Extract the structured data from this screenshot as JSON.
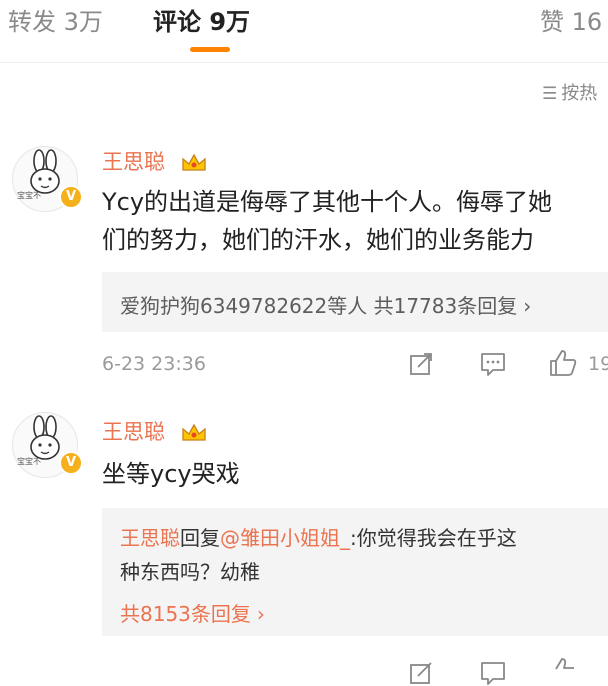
{
  "tabs": [
    {
      "label": "转发 3万"
    },
    {
      "label": "评论 9万"
    },
    {
      "label": "赞 16"
    }
  ],
  "sort_label": "按热",
  "comments": [
    {
      "username": "王思聪",
      "avatar_caption": "宝宝不",
      "text_lines": [
        "Ycy的出道是侮辱了其他十个人。侮辱了她",
        "们的努力，她们的汗水，她们的业务能力"
      ],
      "reply_summary": "爱狗护狗6349782622等人 共17783条回复",
      "time": "6-23 23:36",
      "like_count": "19"
    },
    {
      "username": "王思聪",
      "avatar_caption": "宝宝不",
      "text_lines": [
        "坐等ycy哭戏"
      ],
      "reply": {
        "author": "王思聪",
        "verb": "回复",
        "mention": "@雏田小姐姐_",
        "content_1": ":你觉得我会在乎这",
        "content_2": "种东西吗？幼稚"
      },
      "reply_total": "共8153条回复"
    }
  ],
  "colors": {
    "accent": "#ff8200",
    "username": "#eb7350",
    "badge": "#f6b01a"
  }
}
